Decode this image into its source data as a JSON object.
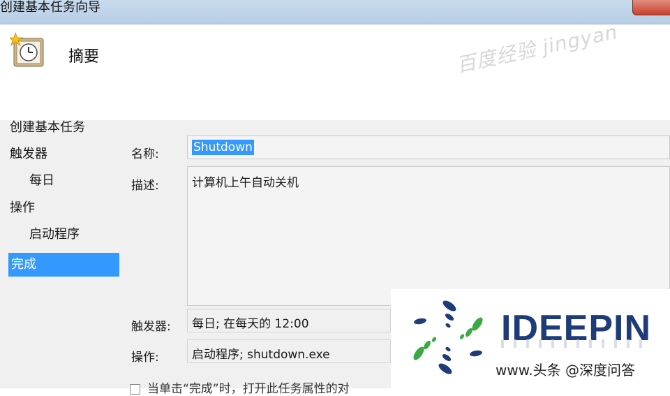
{
  "window": {
    "title": "创建基本任务向导"
  },
  "header": {
    "heading": "摘要",
    "watermark": "百度经验 jingyan"
  },
  "sidebar": {
    "items": [
      {
        "label": "创建基本任务"
      },
      {
        "label": "触发器"
      },
      {
        "label": "每日"
      },
      {
        "label": "操作"
      },
      {
        "label": "启动程序"
      },
      {
        "label": "完成"
      }
    ]
  },
  "form": {
    "name_label": "名称:",
    "name_value": "Shutdown",
    "desc_label": "描述:",
    "desc_value": "计算机上午自动关机",
    "trigger_label": "触发器:",
    "trigger_value": "每日; 在每天的 12:00",
    "action_label": "操作:",
    "action_value": "启动程序; shutdown.exe",
    "checkbox_label": "当单击“完成”时，打开此任务属性的对"
  },
  "overlay": {
    "brand": "IDEEPIN",
    "url": "www.头条 @深度问答"
  },
  "colors": {
    "selection": "#3399ff",
    "brand_blue": "#1e3c78",
    "brand_green": "#3aa843"
  }
}
